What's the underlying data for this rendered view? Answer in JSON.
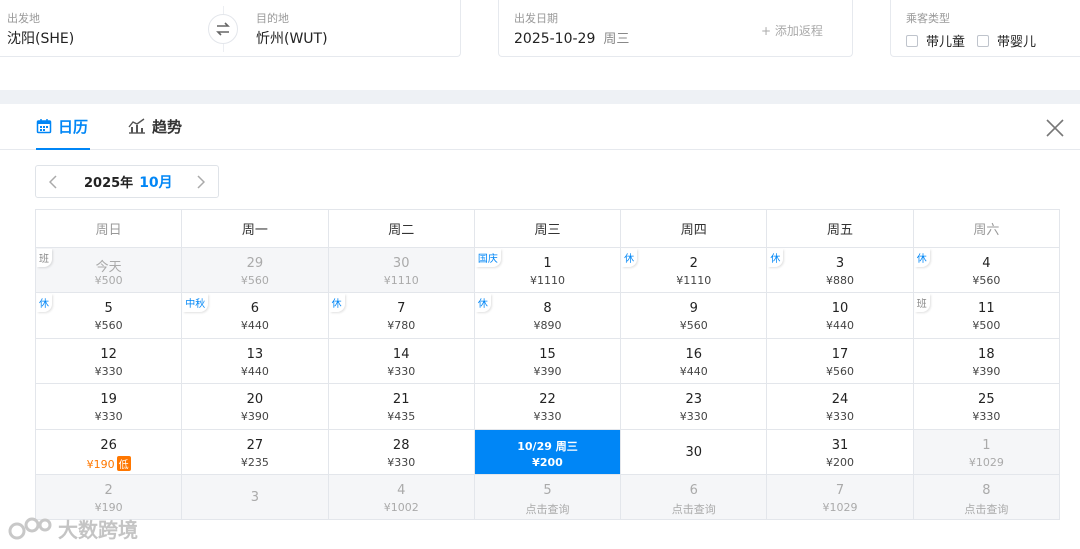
{
  "search": {
    "from_label": "出发地",
    "from_value": "沈阳(SHE)",
    "to_label": "目的地",
    "to_value": "忻州(WUT)",
    "date_label": "出发日期",
    "date_value": "2025-10-29",
    "date_weekday": "周三",
    "add_return": "+ 添加返程",
    "pax_label": "乘客类型",
    "with_child": "带儿童",
    "with_infant": "带婴儿"
  },
  "tabs": {
    "calendar": "日历",
    "trend": "趋势"
  },
  "month_nav": {
    "year": "2025年",
    "month": "10月"
  },
  "weekdays": [
    "周日",
    "周一",
    "周二",
    "周三",
    "周四",
    "周五",
    "周六"
  ],
  "calendar": [
    [
      {
        "day": "今天",
        "price": "¥500",
        "tag": "班",
        "muted": true
      },
      {
        "day": "29",
        "price": "¥560",
        "muted": true
      },
      {
        "day": "30",
        "price": "¥1110",
        "muted": true
      },
      {
        "day": "1",
        "price": "¥1110",
        "tag": "国庆"
      },
      {
        "day": "2",
        "price": "¥1110",
        "tag": "休"
      },
      {
        "day": "3",
        "price": "¥880",
        "tag": "休"
      },
      {
        "day": "4",
        "price": "¥560",
        "tag": "休"
      }
    ],
    [
      {
        "day": "5",
        "price": "¥560",
        "tag": "休"
      },
      {
        "day": "6",
        "price": "¥440",
        "tag": "中秋"
      },
      {
        "day": "7",
        "price": "¥780",
        "tag": "休"
      },
      {
        "day": "8",
        "price": "¥890",
        "tag": "休"
      },
      {
        "day": "9",
        "price": "¥560"
      },
      {
        "day": "10",
        "price": "¥440"
      },
      {
        "day": "11",
        "price": "¥500",
        "tag": "班"
      }
    ],
    [
      {
        "day": "12",
        "price": "¥330"
      },
      {
        "day": "13",
        "price": "¥440"
      },
      {
        "day": "14",
        "price": "¥330"
      },
      {
        "day": "15",
        "price": "¥390"
      },
      {
        "day": "16",
        "price": "¥440"
      },
      {
        "day": "17",
        "price": "¥560"
      },
      {
        "day": "18",
        "price": "¥390"
      }
    ],
    [
      {
        "day": "19",
        "price": "¥330"
      },
      {
        "day": "20",
        "price": "¥390"
      },
      {
        "day": "21",
        "price": "¥435"
      },
      {
        "day": "22",
        "price": "¥330"
      },
      {
        "day": "23",
        "price": "¥330"
      },
      {
        "day": "24",
        "price": "¥330"
      },
      {
        "day": "25",
        "price": "¥330"
      }
    ],
    [
      {
        "day": "26",
        "price": "¥190",
        "low": "低"
      },
      {
        "day": "27",
        "price": "¥235"
      },
      {
        "day": "28",
        "price": "¥330"
      },
      {
        "day": "10/29 周三",
        "price": "¥200",
        "selected": true
      },
      {
        "day": "30",
        "price": ""
      },
      {
        "day": "31",
        "price": "¥200"
      },
      {
        "day": "1",
        "price": "¥1029",
        "muted": true
      }
    ],
    [
      {
        "day": "2",
        "price": "¥190",
        "muted": true
      },
      {
        "day": "3",
        "price": "",
        "muted": true
      },
      {
        "day": "4",
        "price": "¥1002",
        "muted": true
      },
      {
        "day": "5",
        "price": "点击查询",
        "muted": true
      },
      {
        "day": "6",
        "price": "点击查询",
        "muted": true
      },
      {
        "day": "7",
        "price": "¥1029",
        "muted": true
      },
      {
        "day": "8",
        "price": "点击查询",
        "muted": true
      }
    ]
  ],
  "watermark": "大数跨境",
  "colors": {
    "accent": "#0086f6",
    "low_price": "#ff7700"
  }
}
